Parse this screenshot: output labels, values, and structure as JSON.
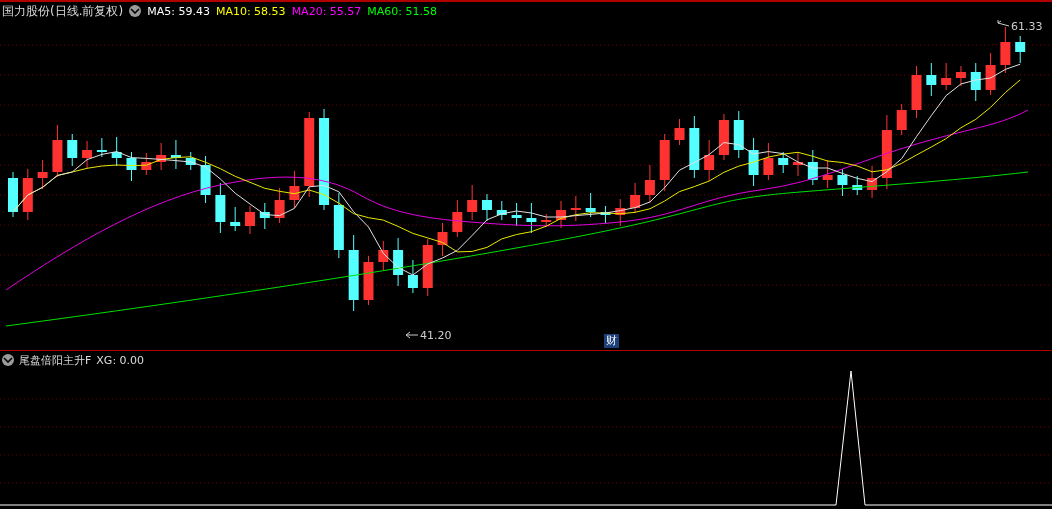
{
  "header": {
    "title": "国力股份(日线.前复权)",
    "ma": [
      {
        "label": "MA5: 59.43",
        "color": "#ffffff"
      },
      {
        "label": "MA10: 58.53",
        "color": "#ffff00"
      },
      {
        "label": "MA20: 55.57",
        "color": "#ff00ff"
      },
      {
        "label": "MA60: 51.58",
        "color": "#00ff00"
      }
    ]
  },
  "chart": {
    "high_label": "61.33",
    "low_label": "41.20",
    "badge": "财"
  },
  "indicator": {
    "title": "尾盘倍阳主升F",
    "reading": "XG: 0.00"
  }
}
